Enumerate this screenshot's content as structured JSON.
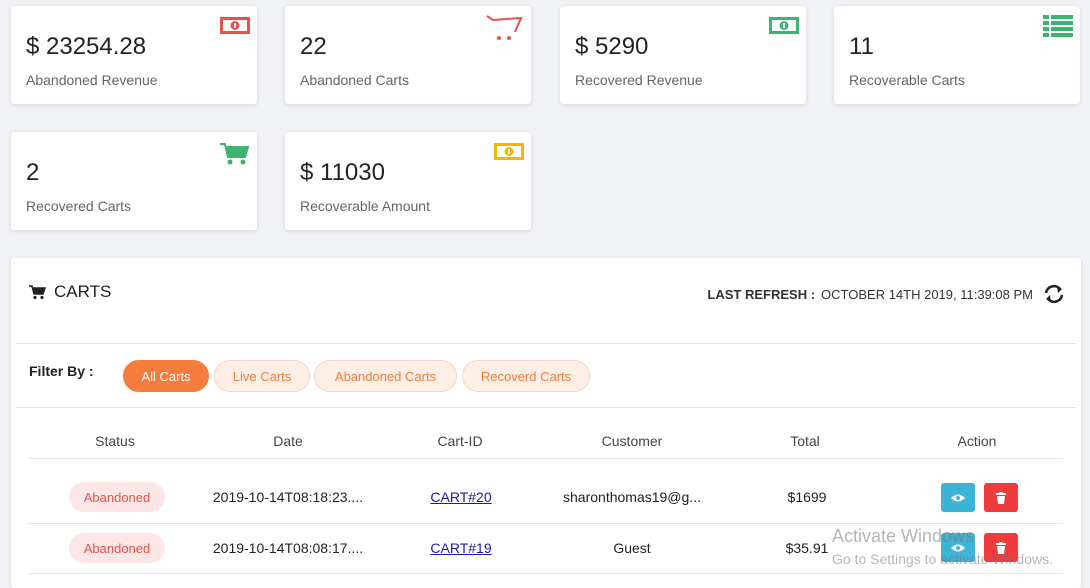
{
  "stats": [
    {
      "value": "$ 23254.28",
      "label": "Abandoned Revenue",
      "icon": "money-bill-icon",
      "color": "#e5534b"
    },
    {
      "value": "22",
      "label": "Abandoned Carts",
      "icon": "shopping-cart-icon",
      "color": "#e5534b"
    },
    {
      "value": "$ 5290",
      "label": "Recovered Revenue",
      "icon": "money-bill-icon",
      "color": "#3cb371"
    },
    {
      "value": "11",
      "label": "Recoverable Carts",
      "icon": "list-icon",
      "color": "#3cb371"
    },
    {
      "value": "2",
      "label": "Recovered Carts",
      "icon": "shopping-cart-icon",
      "color": "#3cb371"
    },
    {
      "value": "$ 11030",
      "label": "Recoverable Amount",
      "icon": "money-bill-icon",
      "color": "#f5b800"
    }
  ],
  "carts": {
    "title": "CARTS",
    "last_refresh_label": "LAST REFRESH :",
    "last_refresh_value": "OCTOBER 14TH 2019, 11:39:08 PM",
    "filter_label": "Filter By :",
    "filters": [
      "All Carts",
      "Live Carts",
      "Abandoned Carts",
      "Recoverd Carts"
    ],
    "active_filter": "All Carts",
    "columns": [
      "Status",
      "Date",
      "Cart-ID",
      "Customer",
      "Total",
      "Action"
    ],
    "rows": [
      {
        "status": "Abandoned",
        "date": "2019-10-14T08:18:23....",
        "cart_id": "CART#20",
        "customer": "sharonthomas19@g...",
        "total": "$1699"
      },
      {
        "status": "Abandoned",
        "date": "2019-10-14T08:08:17....",
        "cart_id": "CART#19",
        "customer": "Guest",
        "total": "$35.91"
      }
    ]
  },
  "watermark": {
    "line1": "Activate Windows",
    "line2": "Go to Settings to activate Windows."
  },
  "accent": "#f47c3c"
}
